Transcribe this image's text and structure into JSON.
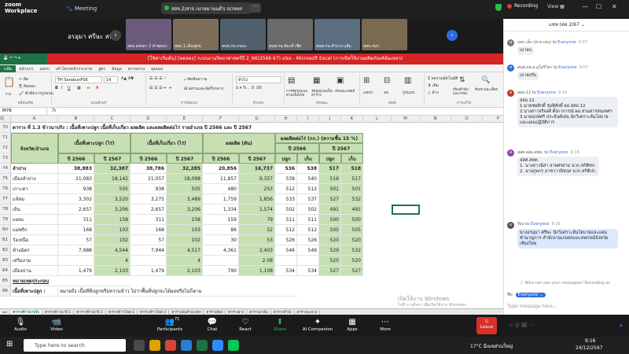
{
  "zoom": {
    "logo_line1": "zoom",
    "logo_line2": "Workplace",
    "meeting_label": "Meeting",
    "viewing_text": "สสจ.2/สาธ เนาหมานนส์'s screen",
    "view_options": "⋯",
    "recording": "Recording",
    "view": "View",
    "thumbnails": [
      {
        "label": "อรอุมา ศรีษะ สนพ.เกษตร..."
      },
      {
        "label": "สสจ.สงขลา 2 คำพุดนา"
      },
      {
        "label": "สสอ.1.เอ็นปูทน"
      },
      {
        "label": "สนพ.กษ.ถนนะ"
      },
      {
        "label": "สนพ.กษ.อิดะดี เชีย"
      },
      {
        "label": "สนพ.กษ.สำบาง แส้ม"
      },
      {
        "label": "สสจ.กษร."
      }
    ],
    "big_name": "อรอุมา ศรีษะ สน..."
  },
  "excel": {
    "title": "[ใช้ค่าเริ่มต้น] [ทดลอง] ระบบงานวิทยาศาสตร์ปี 2_66(2566 67).xlsx - Microsoft Excel (การเปิดใช้งานผลิตภัณฑ์ล้มเหลว)",
    "tabs": [
      "แฟ้ม",
      "หน้าแรก",
      "แทรก",
      "เค้าโครงหน้ากระดาษ",
      "สูตร",
      "ข้อมูล",
      "ตรวจทาน",
      "มุมมอง"
    ],
    "font_name": "TH SarabunPSK",
    "font_size": "14",
    "number_format": "ทั่วไป",
    "groups": [
      "คลิปบอร์ด",
      "แบบอักษร",
      "การจัดแนว",
      "ตัวเลข",
      "ลักษณะ",
      "เซลล์",
      "การแก้ไข"
    ],
    "ribbon_items": {
      "paste": "วาง",
      "cut": "ตัด",
      "copy": "คัดลอก",
      "format_painter": "ตัวคัดวางรูปแบบ",
      "wrap": "ตัดข้อความ",
      "merge": "ผสานและจัดกึ่งกลาง",
      "cond_format": "การจัดรูปแบบตามเงื่อนไข",
      "format_table": "จัดรูปแบบเป็นตาราง",
      "cell_styles": "ลักษณะเซลล์",
      "insert": "แทรก",
      "delete": "ลบ",
      "format": "รูปแบบ",
      "autosum": "ผลรวมอัตโนมัติ",
      "fill": "เติม",
      "clear": "ล้าง",
      "sort": "เรียงลำดับและกรอง",
      "find": "ค้นหาและเลือก"
    },
    "name_box": "M78",
    "fx": "fx",
    "columns": [
      "A",
      "B",
      "C",
      "D",
      "E",
      "F",
      "G",
      "H",
      "I",
      "J",
      "K",
      "L",
      "M",
      "N",
      "O",
      "P",
      "Q"
    ],
    "row70_title": "ตาราง ที่ 1.3 ข้าวนาปรัง : เนื้อที่เพาะปลูก เนื้อที่เก็บเกี่ยว ผลผลิต และผลผลิตต่อไร่ รายอำเภอ ปี 2566 และ ปี 2567",
    "headers": {
      "district": "จังหวัด/อำเภอ",
      "planted": "เนื้อที่เพาะปลูก (ไร่)",
      "harvested": "เนื้อที่เก็บเกี่ยว (ไร่)",
      "production": "ผลผลิต (ตัน)",
      "yield": "ผลผลิตต่อไร่ (กก.) (ความชื้น 15 %)",
      "y2566": "ปี 2566",
      "y2567": "ปี 2567",
      "plant": "ปลูก",
      "harvest": "เก็บ"
    },
    "rows": [
      {
        "n": "70"
      },
      {
        "n": "71"
      },
      {
        "n": "72"
      },
      {
        "n": "73"
      },
      {
        "n": "74",
        "name": "ลำปาง",
        "v": [
          "38,883",
          "32,387",
          "38,786",
          "32,285",
          "20,856",
          "16,737",
          "536",
          "538",
          "517",
          "518"
        ]
      },
      {
        "n": "75",
        "name": "เมืองลำปาง",
        "v": [
          "21,083",
          "18,142",
          "21,057",
          "18,098",
          "11,857",
          "9,357",
          "539",
          "540",
          "516",
          "517"
        ]
      },
      {
        "n": "76",
        "name": "เกาะคา",
        "v": [
          "938",
          "505",
          "938",
          "505",
          "480",
          "253",
          "512",
          "512",
          "501",
          "501"
        ]
      },
      {
        "n": "77",
        "name": "แจ้ห่ม",
        "v": [
          "3,302",
          "3,520",
          "3,275",
          "3,489",
          "1,759",
          "1,856",
          "533",
          "537",
          "527",
          "532"
        ]
      },
      {
        "n": "78",
        "name": "เถิน",
        "v": [
          "2,657",
          "3,206",
          "2,657",
          "3,206",
          "1,334",
          "1,574",
          "502",
          "502",
          "491",
          "491"
        ]
      },
      {
        "n": "79",
        "name": "แม่ทะ",
        "v": [
          "311",
          "158",
          "311",
          "158",
          "159",
          "79",
          "511",
          "511",
          "500",
          "500"
        ]
      },
      {
        "n": "80",
        "name": "แม่พริก",
        "v": [
          "168",
          "103",
          "168",
          "103",
          "86",
          "52",
          "512",
          "512",
          "505",
          "505"
        ]
      },
      {
        "n": "81",
        "name": "วังเหนือ",
        "v": [
          "57",
          "102",
          "57",
          "102",
          "30",
          "53",
          "526",
          "526",
          "520",
          "520"
        ]
      },
      {
        "n": "82",
        "name": "ห้างฉัตร",
        "v": [
          "7,988",
          "4,544",
          "7,944",
          "4,517",
          "4,361",
          "2,403",
          "546",
          "549",
          "529",
          "532"
        ]
      },
      {
        "n": "83",
        "name": "เสริมงาม",
        "v": [
          "",
          "4",
          "",
          "4",
          "",
          "2.08",
          "",
          "",
          "520",
          "520"
        ]
      },
      {
        "n": "84",
        "name": "เมืองปาน",
        "v": [
          "1,479",
          "2,103",
          "1,479",
          "2,103",
          "790",
          "1,108",
          "534",
          "534",
          "527",
          "527"
        ]
      },
      {
        "n": "85",
        "name": "หมายเหตุประกอบ"
      },
      {
        "n": "86",
        "name": "เนื้อที่เพาะปลูก :",
        "note": "หมายถึง เนื้อที่ที่ปลูกหรือหว่านข้าว ไม่ว่าพื้นที่ปลูกจะได้ผลหรือไม่ก็ตาม"
      }
    ],
    "sheets": [
      "ตารางข้าวนาปรัง",
      "ตารางข้าวนาปี 1",
      "ตารางข้าวนาปี 2",
      "ตารางข้าวโพด 1",
      "ตารางข้าวโพด 2",
      "ตารางมันสำปะหลัง",
      "ตารางอ้อย",
      "ตารางยาง",
      "ตารางปาล์ม",
      "ตารางลำไย",
      "ตารางมะม่วง"
    ],
    "watermark_line1": "เปิดใช้งาน Windows",
    "watermark_line2": "ไปที่ การตั้งค่า เพื่อเปิดใช้งาน Windows"
  },
  "chat": {
    "header": "แชท (ต่อ 2/67",
    "messages": [
      {
        "from": "นพร เล็ก (ทาจ.เสน)",
        "to": "Everyone",
        "time": "9:07",
        "text": "เบาคง",
        "color": "#7a7a7a",
        "initial": "น"
      },
      {
        "from": "สนพ.กษ.อ.อุโมริไทร",
        "to": "Everyone",
        "time": "9:07",
        "text": "เบาคงรับ",
        "color": "#2d6cdf",
        "initial": "ส"
      },
      {
        "from": "สสอ.12",
        "to": "Everyone",
        "time": "9:14",
        "text": "สสอ.12\n1.นายชยศักดิ์ รุ่มลิศักดิ์ ผอ.สสอ.12\n2.นางสาวจริจงศ์ ตั้งกาการณ์ ผอ.สวนสารสนเทศฯ\n3.นายฤกษ์ศรี ประจันต์เสน นักวิเคราะห์นโยบายและแผนปฏิบัติการ",
        "color": "#c0392b",
        "initial": "ส"
      },
      {
        "from": "สสศ.สสอ.สพท.",
        "to": "Everyone",
        "time": "9:16",
        "text": "สสศ.สพท.\n1. นางสาวนิสา ลายศรสาม นวก.สกิติชก.\n2. นางภูพกร อาชวาวนิชกุล นวก.สกิติปก.",
        "color": "#8e44ad",
        "initial": "ส"
      },
      {
        "from": "You",
        "to": "Everyone",
        "time": "9:16",
        "text": "นางอรอุมา ศรีษะ นักวิเคราะห์นโยบายและแผนชำนาญการ สำนักงานเกษตรและสหกรณ์จังหวัดเชียงใหม่",
        "color": "#555",
        "initial": "อ"
      }
    ],
    "who_can_see": "Who can see your messages? Recording on",
    "to_label": "To:",
    "to_value": "Everyone",
    "input_placeholder": "Type message here..."
  },
  "toolbar": {
    "items": [
      {
        "label": "Audio",
        "icon": "🎙"
      },
      {
        "label": "Video",
        "icon": "📹"
      },
      {
        "label": "Participants",
        "icon": "👥"
      },
      {
        "label": "Chat",
        "icon": "💬"
      },
      {
        "label": "React",
        "icon": "♡"
      },
      {
        "label": "Share",
        "icon": "⬆"
      },
      {
        "label": "AI Companion",
        "icon": "✦"
      },
      {
        "label": "Apps",
        "icon": "▦"
      },
      {
        "label": "More",
        "icon": "⋯"
      }
    ],
    "participants_count": "71",
    "leave": "Leave"
  },
  "taskbar": {
    "search_placeholder": "Type here to search",
    "weather": "17°C มีเมฆส่วนใหญ่",
    "time": "9:16",
    "date": "24/12/2567"
  },
  "colors": {
    "excel_green": "#1e7145",
    "title_red": "#d42424",
    "table_green": "#c6e0b4",
    "zoom_blue": "#2d6cdf",
    "leave_red": "#d9302c"
  }
}
